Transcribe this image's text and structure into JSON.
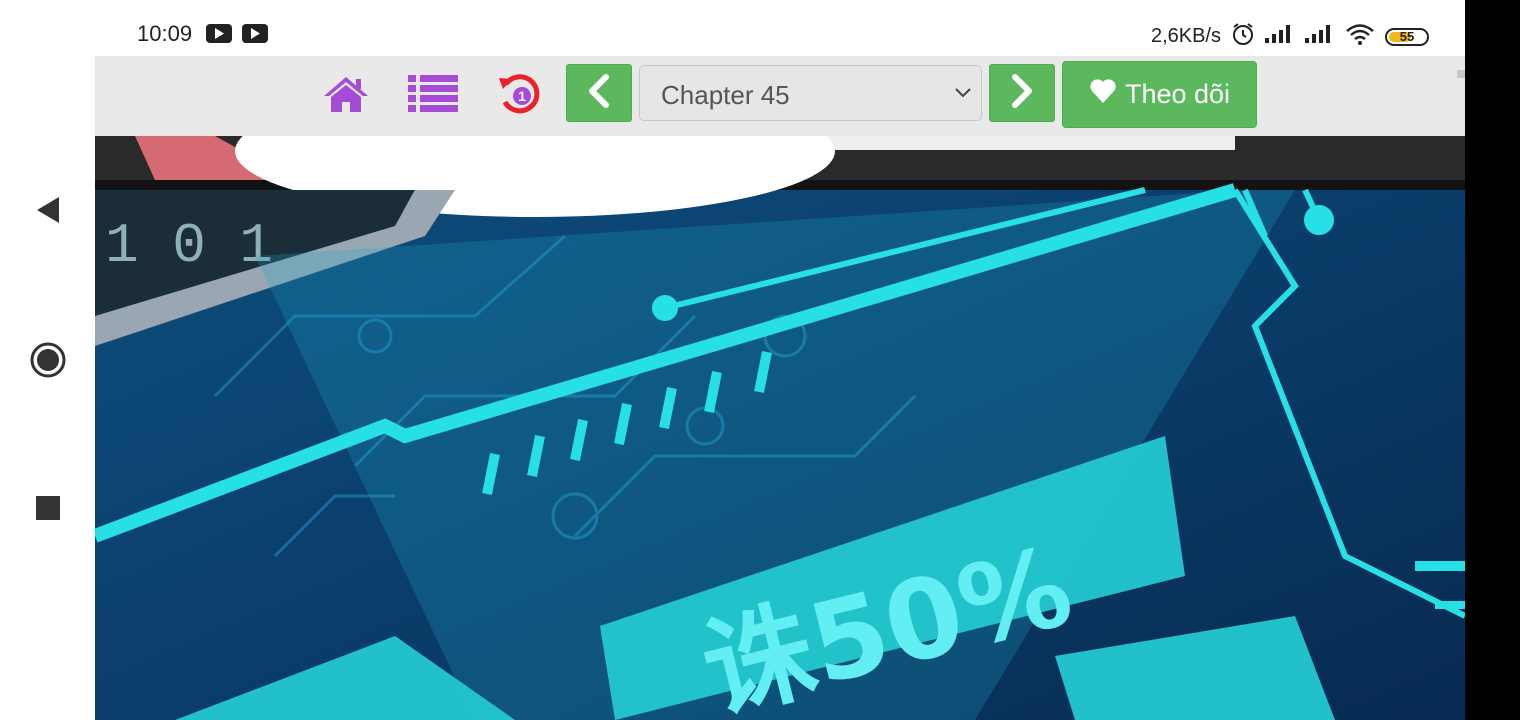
{
  "status_bar": {
    "time": "10:09",
    "network_speed": "2,6KB/s",
    "battery_level": "55",
    "icons": [
      "youtube-icon",
      "youtube-icon",
      "alarm-icon",
      "signal-icon",
      "signal-icon",
      "wifi-icon",
      "battery-icon"
    ]
  },
  "nav_bar": {
    "icons": [
      "back-triangle-icon",
      "home-circle-icon",
      "recents-square-icon"
    ]
  },
  "toolbar": {
    "home_icon": "home-icon",
    "list_icon": "list-icon",
    "history_icon": "history-icon",
    "history_count": "1",
    "prev_icon": "chevron-left-icon",
    "next_icon": "chevron-right-icon",
    "chapter_selected": "Chapter 45",
    "follow_label": "Theo dõi",
    "follow_icon": "heart-icon",
    "accent_color": "#5cb85c",
    "icon_color": "#a64bd6",
    "history_color": "#e8212a"
  },
  "comic": {
    "panel_text_1": "1 0 1",
    "panel_text_2": "诛50%"
  }
}
